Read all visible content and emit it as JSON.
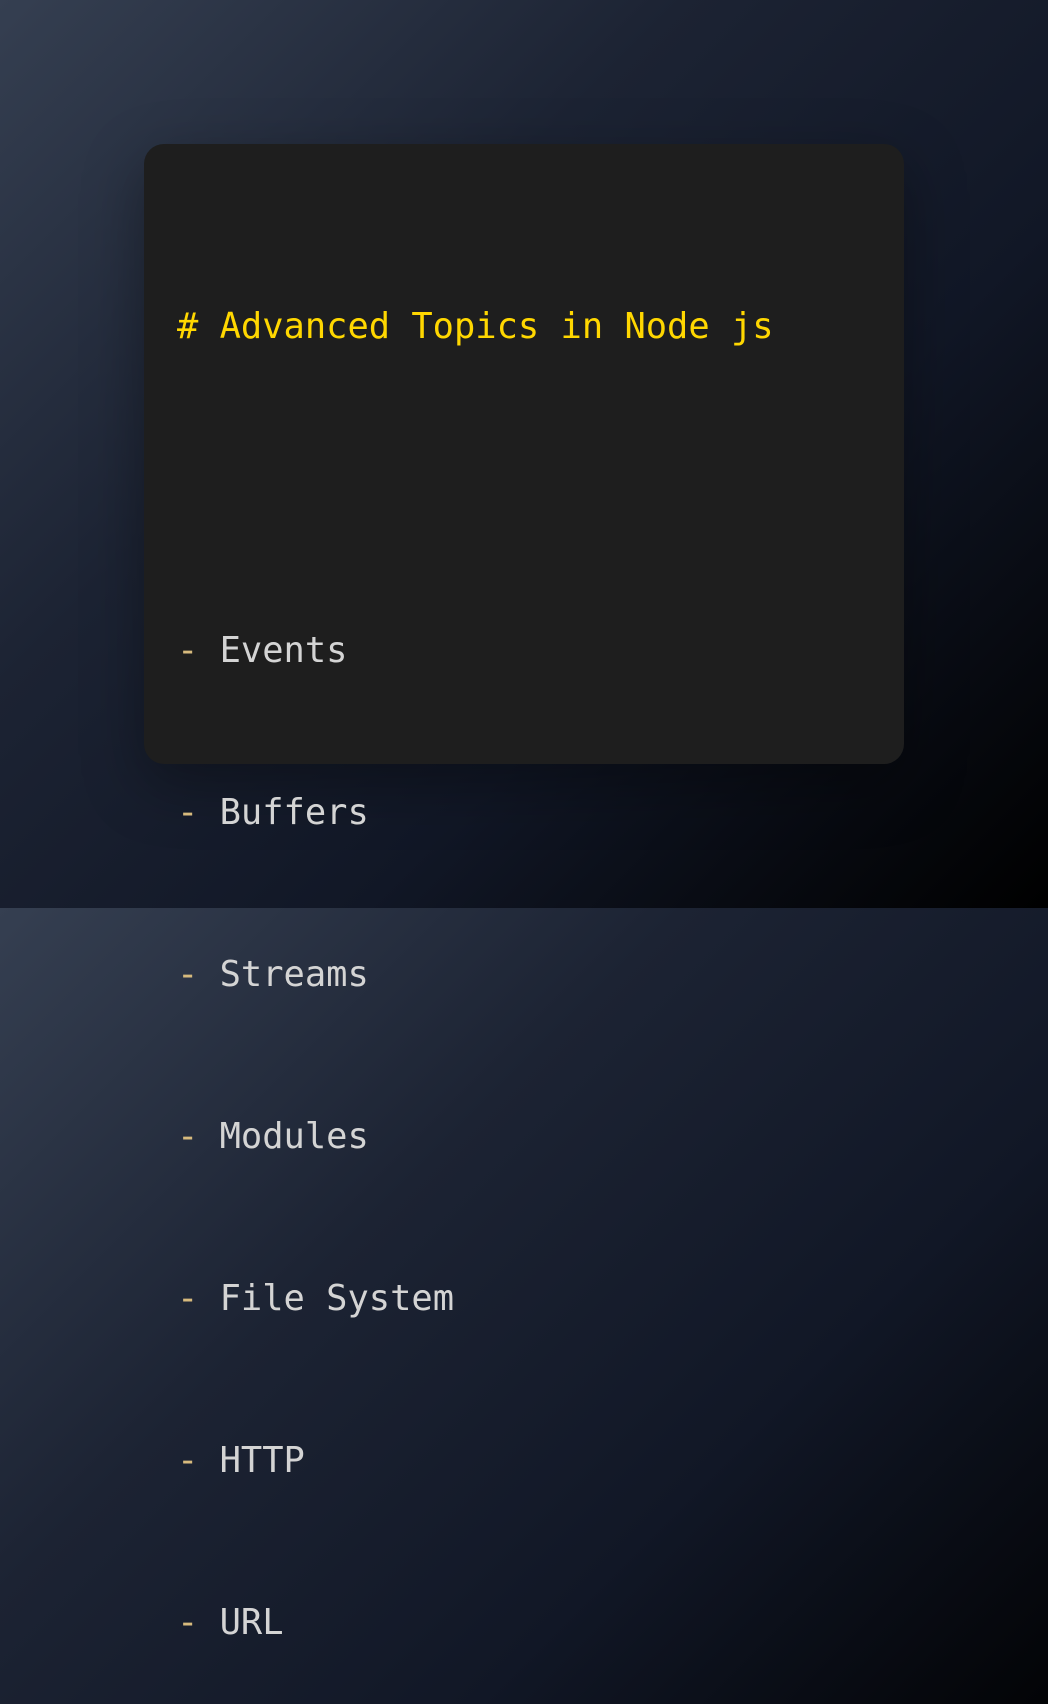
{
  "snippet": {
    "heading": "# Advanced Topics in Node js",
    "bullet": "-",
    "items": [
      "Events",
      "Buffers",
      "Streams",
      "Modules",
      "File System",
      "HTTP",
      "URL"
    ]
  },
  "colors": {
    "heading": "#ffd700",
    "bullet": "#d7ba7d",
    "text": "#d4d4d4",
    "card": "#1e1e1e"
  }
}
